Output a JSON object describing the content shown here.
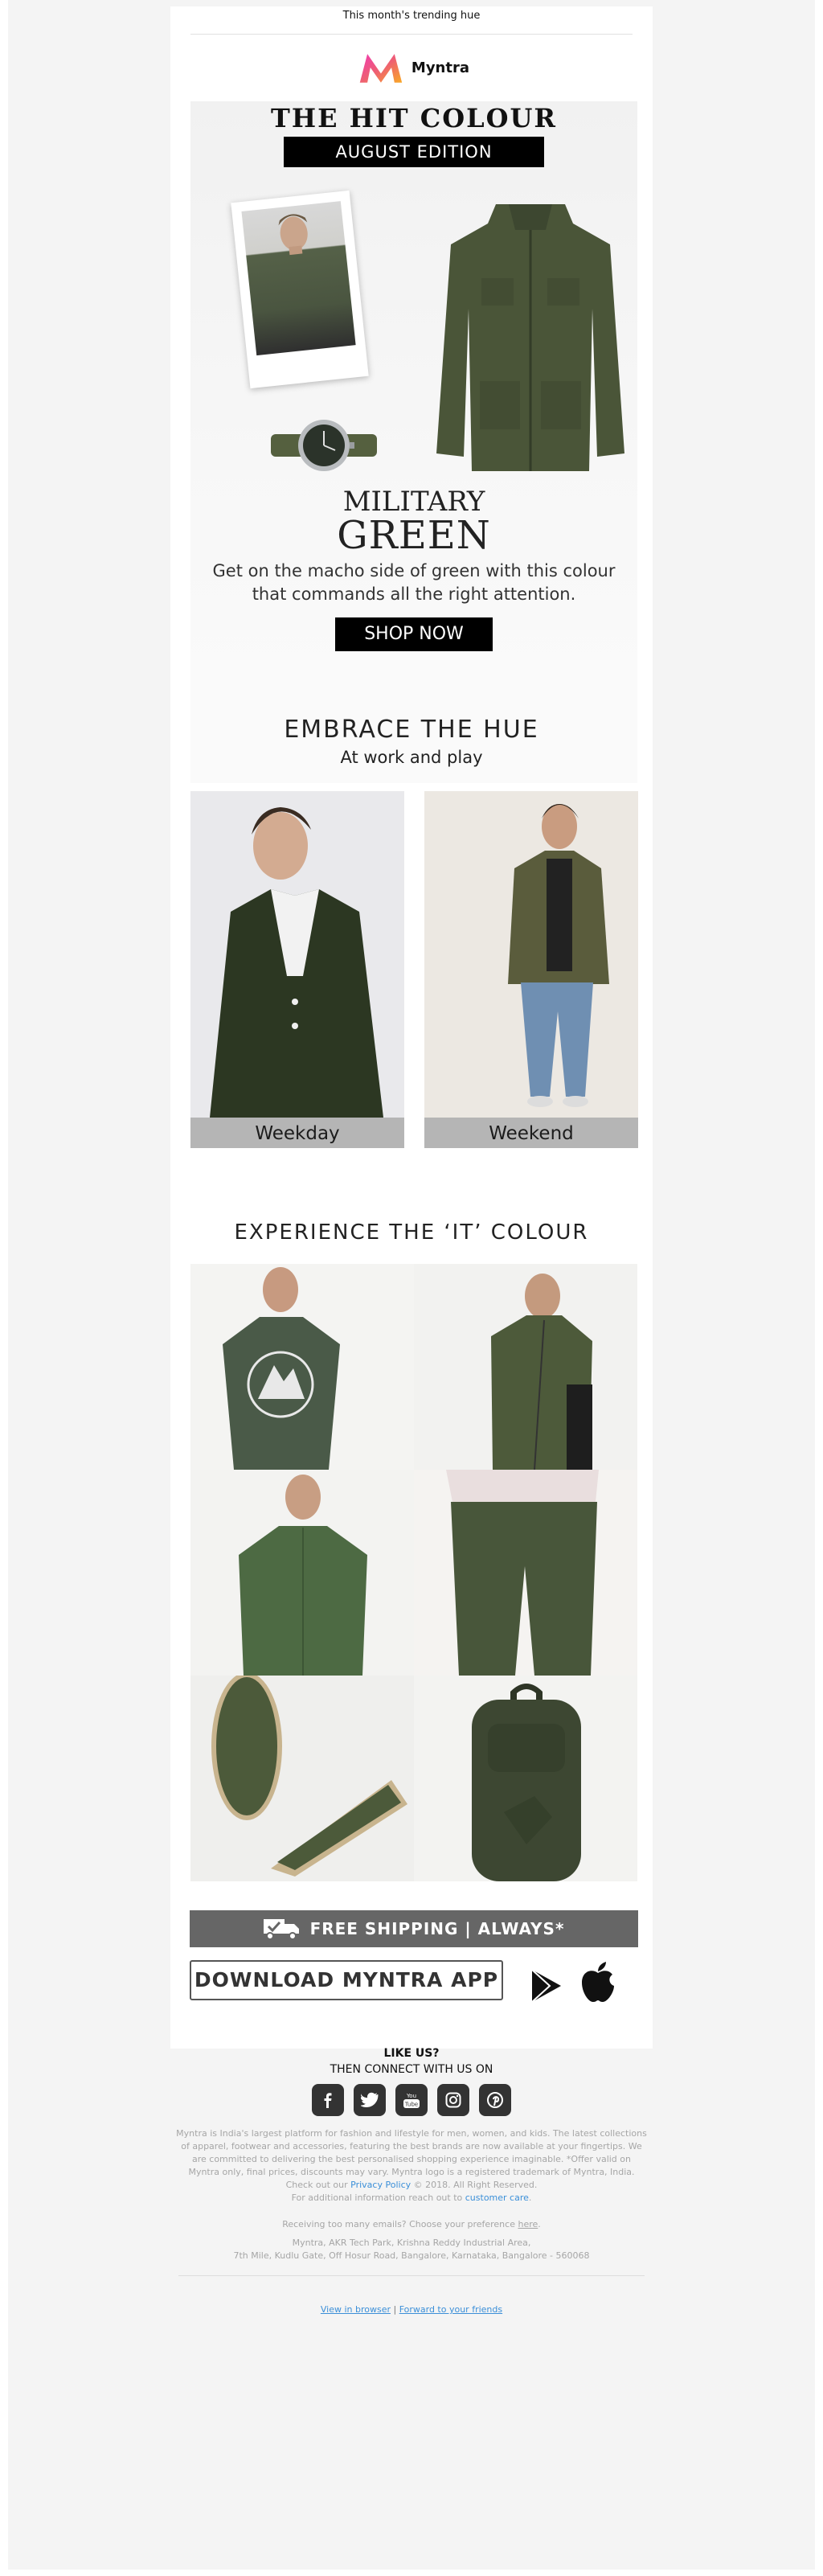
{
  "preheader": "This month's trending hue",
  "brand": {
    "name": "Myntra"
  },
  "hero": {
    "title": "THE HIT COLOUR",
    "edition": "AUGUST EDITION",
    "name_line1": "MILITARY",
    "name_line2": "GREEN",
    "description": "Get on the macho side of green with this colour that commands all the right attention.",
    "cta": "SHOP NOW"
  },
  "embrace": {
    "title": "EMBRACE THE HUE",
    "subtitle": "At work and play",
    "looks": [
      {
        "label": "Weekday"
      },
      {
        "label": "Weekend"
      }
    ]
  },
  "experience": {
    "title": "EXPERIENCE THE ‘IT’ COLOUR",
    "products": [
      "graphic-tshirt",
      "hooded-jacket",
      "mandarin-shirt",
      "chinos",
      "espadrilles",
      "backpack"
    ]
  },
  "banners": {
    "shipping": "FREE SHIPPING | ALWAYS*",
    "download": "DOWNLOAD MYNTRA APP"
  },
  "footer": {
    "like_us": "LIKE US?",
    "connect": "THEN CONNECT WITH US ON",
    "social": [
      "facebook-icon",
      "twitter-icon",
      "youtube-icon",
      "instagram-icon",
      "pinterest-icon"
    ],
    "legal_text": "Myntra is India's largest platform for fashion and lifestyle for men, women, and kids. The latest collections of apparel, footwear and accessories, featuring the best brands are now available at your fingertips. We are committed to delivering the best personalised shopping experience imaginable. *Offer valid on Myntra only, final prices, discounts may vary. Myntra logo is a registered trademark of Myntra, India. Check out our",
    "privacy_link": "Privacy Policy",
    "legal_text_2": "© 2018. All Right Reserved.",
    "info_text": "For additional information reach out to",
    "care_link": "customer care",
    "pref_text": "Receiving too many emails? Choose your preference",
    "pref_link": "here",
    "address_1": "Myntra, AKR Tech Park, Krishna Reddy Industrial Area,",
    "address_2": "7th Mile, Kudlu Gate, Off Hosur Road, Bangalore, Karnataka, Bangalore - 560068",
    "view_browser": "View in browser",
    "forward": "Forward to your friends"
  },
  "colors": {
    "accent": "#e8336f",
    "military_green": "#4b5a3b",
    "footer_text": "#a6a6a6",
    "link": "#3b8fd8"
  }
}
